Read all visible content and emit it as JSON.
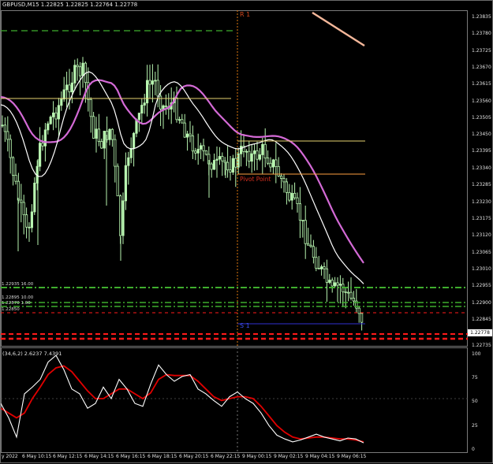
{
  "window": {
    "title": "GBPUSD,M15  1.22825 1.22825 1.22764 1.22778",
    "oscillator_title": "(34,6,2) 2.6237 7.4391"
  },
  "levels": {
    "r1": "R 1",
    "pivot": "Pivot Point",
    "s1": "S 1"
  },
  "left_tags": [
    "1.22935 16.00",
    "1.22895 10.00",
    "1.22870 1.00",
    "1.22850"
  ],
  "current_price": "1.22778",
  "price_axis": [
    "1.23835",
    "1.23780",
    "1.23725",
    "1.23670",
    "1.23615",
    "1.23560",
    "1.23505",
    "1.23450",
    "1.23395",
    "1.23340",
    "1.23285",
    "1.23230",
    "1.23175",
    "1.23120",
    "1.23065",
    "1.23010",
    "1.22955",
    "1.22900",
    "1.22845",
    "1.22735"
  ],
  "osc_axis": [
    "100",
    "75",
    "50",
    "25",
    "0"
  ],
  "time_axis": [
    "y 2022",
    "6 May 10:15",
    "6 May 12:15",
    "6 May 14:15",
    "6 May 16:15",
    "6 May 18:15",
    "6 May 20:15",
    "6 May 22:15",
    "9 May 00:15",
    "9 May 02:15",
    "9 May 04:15",
    "9 May 06:15"
  ],
  "colors": {
    "background": "#000000",
    "candle": "#b8f5b0",
    "ma_slow": "#d46ad6",
    "ma_fast": "#ffffff",
    "r1": "#e07a10",
    "pivot": "#ffa040",
    "s1": "#3030d0",
    "support_dashed": "#3fae2e",
    "red_dashes": "#ff1a1a",
    "osc_main": "#ffffff",
    "osc_signal": "#e00000"
  },
  "chart_data": {
    "type": "candlestick",
    "symbol": "GBPUSD",
    "timeframe": "M15",
    "ohlc_last": {
      "open": 1.22825,
      "high": 1.22825,
      "low": 1.22764,
      "close": 1.22778
    },
    "ylim": [
      1.2273,
      1.2386
    ],
    "osc_ylim": [
      0,
      100
    ]
  }
}
